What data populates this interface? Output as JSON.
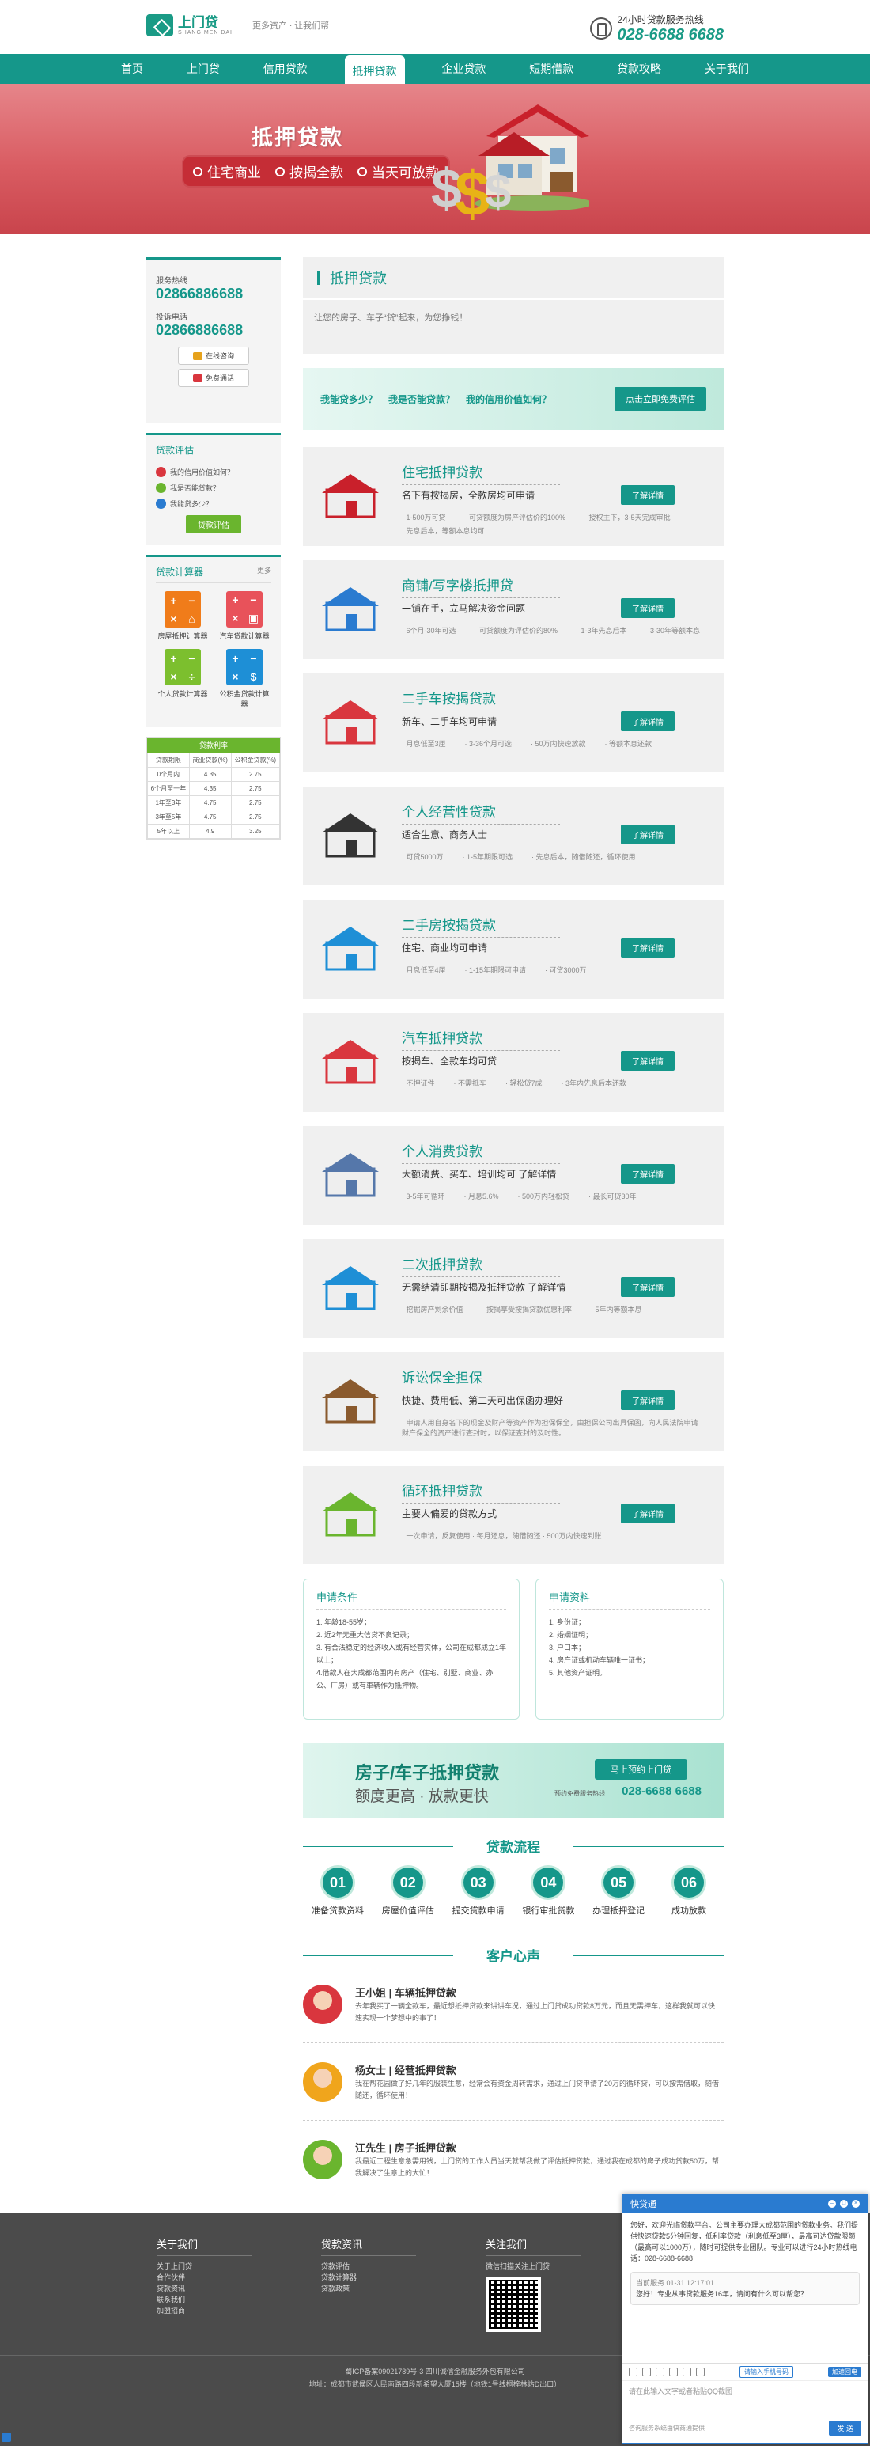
{
  "header": {
    "logo_name": "上门贷",
    "logo_pinyin": "SHANG MEN DAI",
    "slogan": "更多资产 · 让我们帮",
    "hotline_label": "24小时贷款服务热线",
    "hotline_number": "028-6688 6688"
  },
  "nav": [
    "首页",
    "上门贷",
    "信用贷款",
    "抵押贷款",
    "企业贷款",
    "短期借款",
    "贷款攻略",
    "关于我们"
  ],
  "banner": {
    "title": "抵押贷款",
    "tags": [
      "住宅商业",
      "按揭全款",
      "当天可放款"
    ]
  },
  "sidebar": {
    "service_label": "服务热线",
    "service_phone": "02866886688",
    "complaint_label": "投诉电话",
    "complaint_phone": "02866886688",
    "online_consult": "在线咨询",
    "free_call": "免费通话",
    "eval_title": "贷款评估",
    "eval_items": [
      "我的信用价值如何？",
      "我是否能贷款？",
      "我能贷多少？"
    ],
    "eval_button": "贷款评估",
    "calc_title": "贷款计算器",
    "calc_more": "更多",
    "calculators": [
      "房屋抵押计算器",
      "汽车贷款计算器",
      "个人贷款计算器",
      "公积金贷款计算器"
    ],
    "rate_title": "贷款利率",
    "rate_headers": [
      "贷款期限",
      "商业贷款(%)",
      "公积金贷款(%)"
    ],
    "rate_rows": [
      [
        "0个月内",
        "4.35",
        "2.75"
      ],
      [
        "6个月至一年",
        "4.35",
        "2.75"
      ],
      [
        "1年至3年",
        "4.75",
        "2.75"
      ],
      [
        "3年至5年",
        "4.75",
        "2.75"
      ],
      [
        "5年以上",
        "4.9",
        "3.25"
      ]
    ]
  },
  "main": {
    "title": "抵押贷款",
    "intro": "让您的房子、车子“贷”起来，为您挣钱！",
    "cta_questions": [
      "我能贷多少？",
      "我是否能贷款？",
      "我的信用价值如何？"
    ],
    "cta_button": "点击立即免费评估",
    "detail_button": "了解详情",
    "products": [
      {
        "title": "住宅抵押贷款",
        "desc": "名下有按揭房，全款房均可申请",
        "meta": [
          "· 1-500万可贷",
          "· 可贷额度为房产评估价的100%",
          "· 授权主下，3-5天完成审批",
          "· 先息后本，等额本息均可"
        ]
      },
      {
        "title": "商铺/写字楼抵押贷",
        "desc": "一铺在手，立马解决资金问题",
        "meta": [
          "· 6个月-30年可选",
          "· 可贷额度为评估价的80%",
          "· 1-3年先息后本",
          "· 3-30年等额本息"
        ]
      },
      {
        "title": "二手车按揭贷款",
        "desc": "新车、二手车均可申请",
        "meta": [
          "· 月息低至3厘",
          "· 3-36个月可选",
          "· 50万内快速放款",
          "· 等额本息还款"
        ]
      },
      {
        "title": "个人经营性贷款",
        "desc": "适合生意、商务人士",
        "meta": [
          "· 可贷5000万",
          "· 1-5年期限可选",
          "· 先息后本，随借随还，循环使用"
        ]
      },
      {
        "title": "二手房按揭贷款",
        "desc": "住宅、商业均可申请",
        "meta": [
          "· 月息低至4厘",
          "· 1-15年期限可申请",
          "· 可贷3000万"
        ]
      },
      {
        "title": "汽车抵押贷款",
        "desc": "按揭车、全款车均可贷",
        "meta": [
          "· 不押证件",
          "· 不需抵车",
          "· 轻松贷7成",
          "· 3年内先息后本还款"
        ]
      },
      {
        "title": "个人消费贷款",
        "desc": "大额消费、买车、培训均可 了解详情",
        "meta": [
          "· 3-5年可循环",
          "· 月息5.6%",
          "· 500万内轻松贷",
          "· 最长可贷30年"
        ]
      },
      {
        "title": "二次抵押贷款",
        "desc": "无需结清即期按揭及抵押贷款 了解详情",
        "meta": [
          "· 挖掘房产剩余价值",
          "· 按揭享受按揭贷款优惠利率",
          "· 5年内等额本息"
        ]
      },
      {
        "title": "诉讼保全担保",
        "desc": "快捷、费用低、第二天可出保函办理好",
        "meta": [
          "· 申请人用自身名下的现金及财产等资产作为担保保全，由担保公司出具保函，向人民法院申请财产保全的资产进行查封时，以保证查封的及时性。"
        ]
      },
      {
        "title": "循环抵押贷款",
        "desc": "主要人偏爱的贷款方式",
        "meta": [
          "· 一次申请，反复使用 · 每月还息，随借随还 · 500万内快速到账"
        ]
      }
    ],
    "conditions_title": "申请条件",
    "conditions": [
      "1. 年龄18-55岁；",
      "2. 近2年无重大信贷不良记录；",
      "3. 有合法稳定的经济收入或有经营实体，公司在成都成立1年以上；",
      "4.借款人在大成都范围内有房产（住宅、别墅、商业、办公、厂房）或有車辆作为抵押物。"
    ],
    "materials_title": "申请资料",
    "materials": [
      "1. 身份证；",
      "2. 婚姻证明；",
      "3. 户口本；",
      "4. 房产证或机动车辆唯一证书；",
      "5. 其他资产证明。"
    ],
    "banner2_title": "房子/车子抵押贷款",
    "banner2_sub": "额度更高 · 放款更快",
    "banner2_button": "马上预约上门贷",
    "banner2_phone_label": "预约免费服务热线",
    "banner2_phone": "028-6688 6688",
    "process_title": "贷款流程",
    "steps": [
      {
        "num": "01",
        "label": "准备贷款资料"
      },
      {
        "num": "02",
        "label": "房屋价值评估"
      },
      {
        "num": "03",
        "label": "提交贷款申请"
      },
      {
        "num": "04",
        "label": "银行审批贷款"
      },
      {
        "num": "05",
        "label": "办理抵押登记"
      },
      {
        "num": "06",
        "label": "成功放款"
      }
    ],
    "testimonials_title": "客户心声",
    "testimonials": [
      {
        "name": "王小姐 | 车辆抵押贷款",
        "text": "去年我买了一辆全款车，最近想抵押贷款来讲讲车况，通过上门贷成功贷款8万元，而且无需押车，这样我就可以快速实现一个梦想中的事了！"
      },
      {
        "name": "杨女士 | 经营抵押贷款",
        "text": "我在帮花园做了好几年的服装生意，经常会有资金周转需求，通过上门贷申请了20万的循环贷，可以按需借取，随借随还，循环使用！"
      },
      {
        "name": "江先生 | 房子抵押贷款",
        "text": "我最近工程生意急需用钱，上门贷的工作人员当天就帮我做了评估抵押贷款，通过我在成都的房子成功贷款50万，帮我解决了生意上的大忙！"
      }
    ]
  },
  "footer": {
    "about_title": "关于我们",
    "about_links": [
      "关于上门贷",
      "合作伙伴",
      "贷款资讯",
      "联系我们",
      "加盟招商"
    ],
    "news_title": "贷款资讯",
    "news_links": [
      "贷款评估",
      "贷款计算器",
      "贷款政策"
    ],
    "follow_title": "关注我们",
    "follow_text": "微信扫描关注上门贷",
    "icp": "蜀ICP备案09021789号-3   四川诚信金融服务外包有限公司",
    "address": "地址：成都市武侯区人民南路四段新希望大厦15楼（地铁1号线桐梓林站D出口）"
  },
  "chat": {
    "title": "快贷通",
    "welcome": "您好，欢迎光临贷款平台。公司主要办理大成都范围的贷款业务。我们提供快速贷款5分钟回复，低利率贷款（利息低至3厘），最高可达贷款限额（最高可以1000万），随时可提供专业团队。专业可以进行24小时热线电话：028-6688-6688",
    "agent_time": "当前服务  01-31 12:17:01",
    "agent_msg": "您好！专业从事贷款服务16年，请问有什么可以帮您？",
    "phone_btn": "请输入手机号码",
    "reply_btn": "加速回电",
    "input_placeholder": "请在此输入文字或者粘贴QQ截图",
    "footer_note": "咨询服务系统由快商通提供",
    "send_label": "发 送"
  }
}
